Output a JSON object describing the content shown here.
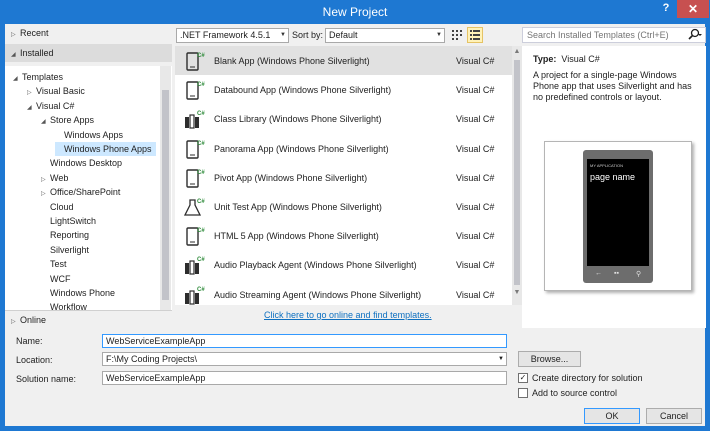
{
  "window": {
    "title": "New Project",
    "help": "?",
    "close": "✕"
  },
  "nav": {
    "recent": "Recent",
    "installed": "Installed",
    "online": "Online",
    "tree": [
      {
        "label": "Templates",
        "tri": "◢",
        "indent": 0
      },
      {
        "label": "Visual Basic",
        "tri": "▷",
        "indent": 1
      },
      {
        "label": "Visual C#",
        "tri": "◢",
        "indent": 1
      },
      {
        "label": "Store Apps",
        "tri": "◢",
        "indent": 2
      },
      {
        "label": "Windows Apps",
        "tri": "",
        "indent": 3
      },
      {
        "label": "Windows Phone Apps",
        "tri": "",
        "indent": 3
      },
      {
        "label": "Windows Desktop",
        "tri": "",
        "indent": 2
      },
      {
        "label": "Web",
        "tri": "▷",
        "indent": 2
      },
      {
        "label": "Office/SharePoint",
        "tri": "▷",
        "indent": 2
      },
      {
        "label": "Cloud",
        "tri": "",
        "indent": 2
      },
      {
        "label": "LightSwitch",
        "tri": "",
        "indent": 2
      },
      {
        "label": "Reporting",
        "tri": "",
        "indent": 2
      },
      {
        "label": "Silverlight",
        "tri": "",
        "indent": 2
      },
      {
        "label": "Test",
        "tri": "",
        "indent": 2
      },
      {
        "label": "WCF",
        "tri": "",
        "indent": 2
      },
      {
        "label": "Windows Phone",
        "tri": "",
        "indent": 2
      },
      {
        "label": "Workflow",
        "tri": "",
        "indent": 2
      }
    ]
  },
  "toolbar": {
    "framework": ".NET Framework 4.5.1",
    "sort_label": "Sort by:",
    "sort_value": "Default"
  },
  "search": {
    "placeholder": "Search Installed Templates (Ctrl+E)"
  },
  "templates": [
    {
      "name": "Blank App (Windows Phone Silverlight)",
      "lang": "Visual C#",
      "icon": "phone-icon"
    },
    {
      "name": "Databound App (Windows Phone Silverlight)",
      "lang": "Visual C#",
      "icon": "phone-icon"
    },
    {
      "name": "Class Library (Windows Phone Silverlight)",
      "lang": "Visual C#",
      "icon": "library-icon"
    },
    {
      "name": "Panorama App (Windows Phone Silverlight)",
      "lang": "Visual C#",
      "icon": "phone-icon"
    },
    {
      "name": "Pivot App (Windows Phone Silverlight)",
      "lang": "Visual C#",
      "icon": "phone-icon"
    },
    {
      "name": "Unit Test App (Windows Phone Silverlight)",
      "lang": "Visual C#",
      "icon": "flask-icon"
    },
    {
      "name": "HTML 5 App (Windows Phone Silverlight)",
      "lang": "Visual C#",
      "icon": "phone-icon"
    },
    {
      "name": "Audio Playback Agent (Windows Phone Silverlight)",
      "lang": "Visual C#",
      "icon": "library-icon"
    },
    {
      "name": "Audio Streaming Agent (Windows Phone Silverlight)",
      "lang": "Visual C#",
      "icon": "library-icon"
    }
  ],
  "online_link": "Click here to go online and find templates.",
  "details": {
    "type_label": "Type:",
    "type_value": "Visual C#",
    "description": "A project for a single-page Windows Phone app that uses Silverlight and has no predefined controls or layout.",
    "preview_page_name": "page name",
    "preview_app_title": "MY APPLICATION"
  },
  "form": {
    "name_label": "Name:",
    "name_value": "WebServiceExampleApp",
    "location_label": "Location:",
    "location_value": "F:\\My Coding Projects\\",
    "solution_label": "Solution name:",
    "solution_value": "WebServiceExampleApp",
    "browse": "Browse...",
    "create_dir": "Create directory for solution",
    "create_dir_checked": true,
    "source_control": "Add to source control",
    "source_control_checked": false,
    "ok": "OK",
    "cancel": "Cancel"
  },
  "colors": {
    "titlebar": "#1e78d2",
    "close": "#c75050",
    "selection": "#cde8ff",
    "link": "#0e70c0"
  }
}
